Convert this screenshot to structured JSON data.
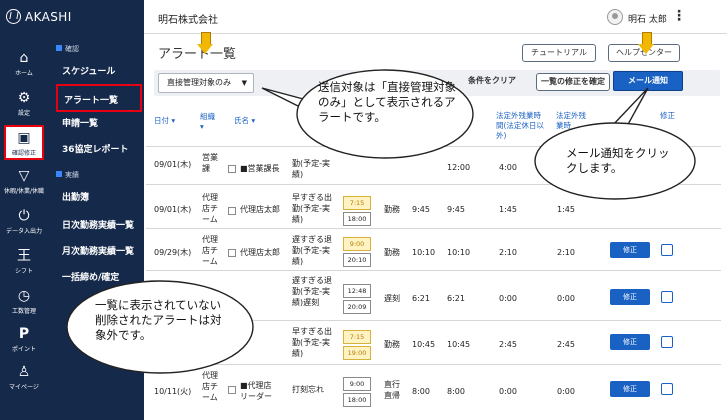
{
  "brand": {
    "name": "AKASHI"
  },
  "header": {
    "company": "明石株式会社",
    "user": "明石 太郎"
  },
  "iconbar": [
    {
      "icon": "home-icon",
      "label": "ホーム"
    },
    {
      "icon": "gear-icon",
      "label": "設定"
    },
    {
      "icon": "clipboard-icon",
      "label": "確認修正",
      "active": true
    },
    {
      "icon": "filter-icon",
      "label": "休暇/休業/休職"
    },
    {
      "icon": "power-icon",
      "label": "データ入出力"
    },
    {
      "icon": "shift-icon",
      "label": "シフト"
    },
    {
      "icon": "clock-icon",
      "label": "工数管理"
    },
    {
      "icon": "point-icon",
      "label": "ポイント"
    },
    {
      "icon": "person-icon",
      "label": "マイページ"
    }
  ],
  "nav": {
    "section_check": "確認",
    "items_check": [
      "スケジュール",
      "アラート一覧",
      "申請一覧",
      "36協定レポート"
    ],
    "section_result": "実績",
    "items_result": [
      "出勤簿",
      "日次勤務実績一覧",
      "月次勤務実績一覧",
      "一括締め/確定"
    ]
  },
  "page": {
    "title": "アラート一覧",
    "tutorial_button": "チュートリアル",
    "help_button": "ヘルプセンター",
    "filter_select": "直接管理対象のみ",
    "clear_button": "条件をクリア",
    "bulk_fix_button": "一覧の修正を確定",
    "mail_button": "メール通知"
  },
  "table": {
    "headers": {
      "date": "日付",
      "org": "組織",
      "name": "氏名",
      "overtime": "法定外残業時間(法定休日以外)",
      "overtime2": "法定外残業時",
      "fix": "修正"
    },
    "rows": [
      {
        "date": "09/01(木)",
        "org": "営業課",
        "name": "■営業課長",
        "alert": "勤(予定-実績)",
        "t1": "",
        "t2": "",
        "kind": "",
        "in": "",
        "out": "12:00",
        "ot": "4:00",
        "ot2": ""
      },
      {
        "date": "09/01(木)",
        "org": "代理店チーム",
        "name": "代理店太郎",
        "alert": "早すぎる出勤(予定-実績)",
        "t1": "7:15",
        "t2": "18:00",
        "kind": "勤務",
        "in": "9:45",
        "out": "9:45",
        "ot": "1:45",
        "ot2": "1:45"
      },
      {
        "date": "09/29(木)",
        "org": "代理店チーム",
        "name": "代理店太郎",
        "alert": "遅すぎる退勤(予定-実績)",
        "t1": "9:00",
        "t2": "20:10",
        "kind": "勤務",
        "in": "10:10",
        "out": "10:10",
        "ot": "2:10",
        "ot2": "2:10"
      },
      {
        "date": "",
        "org": "",
        "name": "",
        "alert": "遅すぎる退勤(予定-実績)遅刻",
        "t1": "12:48",
        "t2": "20:09",
        "kind": "遅刻",
        "in": "6:21",
        "out": "6:21",
        "ot": "0:00",
        "ot2": "0:00"
      },
      {
        "date": "",
        "org": "",
        "name": "",
        "alert": "早すぎる出勤(予定-実績)",
        "t1": "7:15",
        "t2": "19:00",
        "kind": "勤務",
        "in": "10:45",
        "out": "10:45",
        "ot": "2:45",
        "ot2": "2:45"
      },
      {
        "date": "10/11(火)",
        "org": "代理店チーム",
        "name": "■代理店リーダー",
        "alert": "打刻忘れ",
        "t1": "9:00",
        "t2": "18:00",
        "kind": "直行直帰",
        "in": "8:00",
        "out": "8:00",
        "ot": "0:00",
        "ot2": "0:00"
      }
    ],
    "edit_label": "修正"
  },
  "callouts": {
    "send_target": "送信対象は「直接管理対象のみ」として表示されるアラートです。",
    "mail": "メール通知をクリックします。",
    "deleted": "一覧に表示されていない削除されたアラートは対象外です。"
  },
  "colors": {
    "sidebar": "#15294b",
    "primary": "#1a61c4",
    "highlight": "#e60012",
    "arrow": "#f2b701"
  }
}
